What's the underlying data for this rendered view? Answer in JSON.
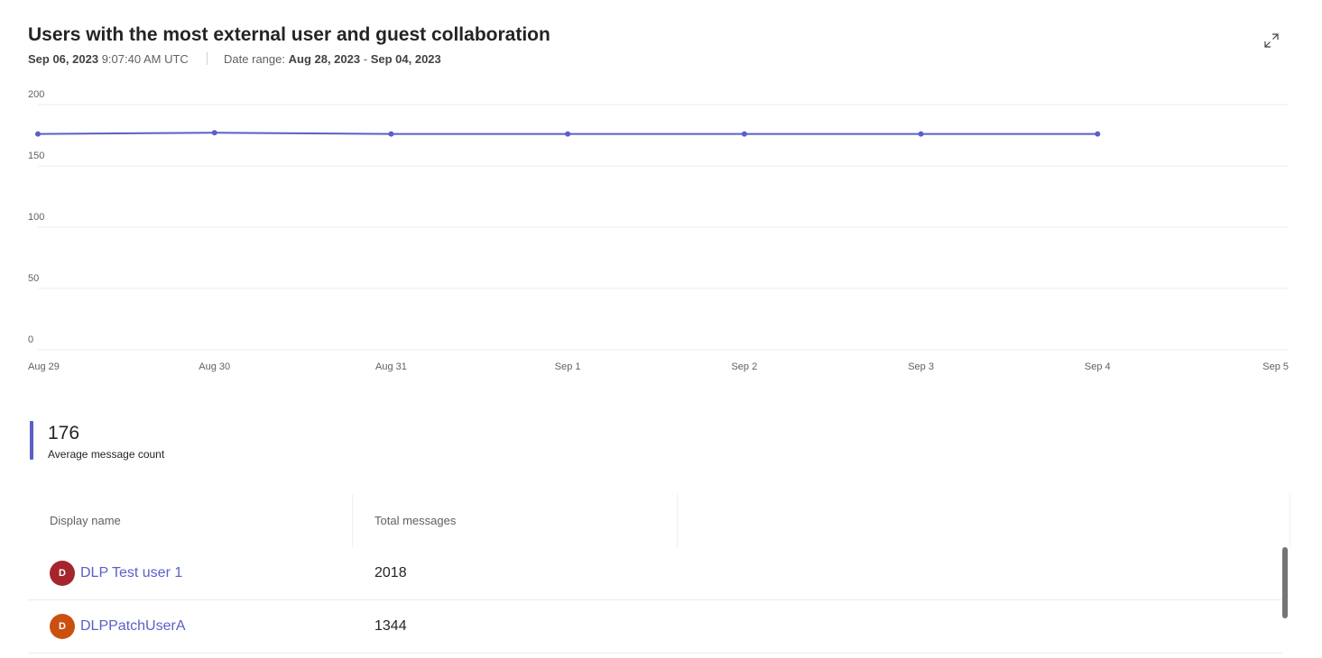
{
  "header": {
    "title": "Users with the most external user and guest collaboration",
    "report_date": "Sep 06, 2023",
    "report_time": "9:07:40 AM UTC",
    "date_range_label": "Date range:",
    "date_range_start": "Aug 28, 2023",
    "date_range_dash": "-",
    "date_range_end": "Sep 04, 2023",
    "expand_icon": "expand-icon"
  },
  "chart_data": {
    "type": "line",
    "categories": [
      "Aug 29",
      "Aug 30",
      "Aug 31",
      "Sep 1",
      "Sep 2",
      "Sep 3",
      "Sep 4",
      "Sep 5"
    ],
    "series": [
      {
        "values": [
          176,
          177,
          176,
          176,
          176,
          176,
          176,
          null
        ]
      }
    ],
    "ylim": [
      0,
      200
    ],
    "yticks": [
      0,
      50,
      100,
      150,
      200
    ],
    "grid": true,
    "line_color": "#5b5fc7"
  },
  "kpi": {
    "value": "176",
    "label": "Average message count",
    "accent": "#5b5fc7"
  },
  "table": {
    "columns": [
      "Display name",
      "Total messages"
    ],
    "rows": [
      {
        "initial": "D",
        "avatar_color": "#a4262c",
        "name": "DLP Test user 1",
        "total": "2018"
      },
      {
        "initial": "D",
        "avatar_color": "#ca5010",
        "name": "DLPPatchUserA",
        "total": "1344"
      }
    ]
  }
}
